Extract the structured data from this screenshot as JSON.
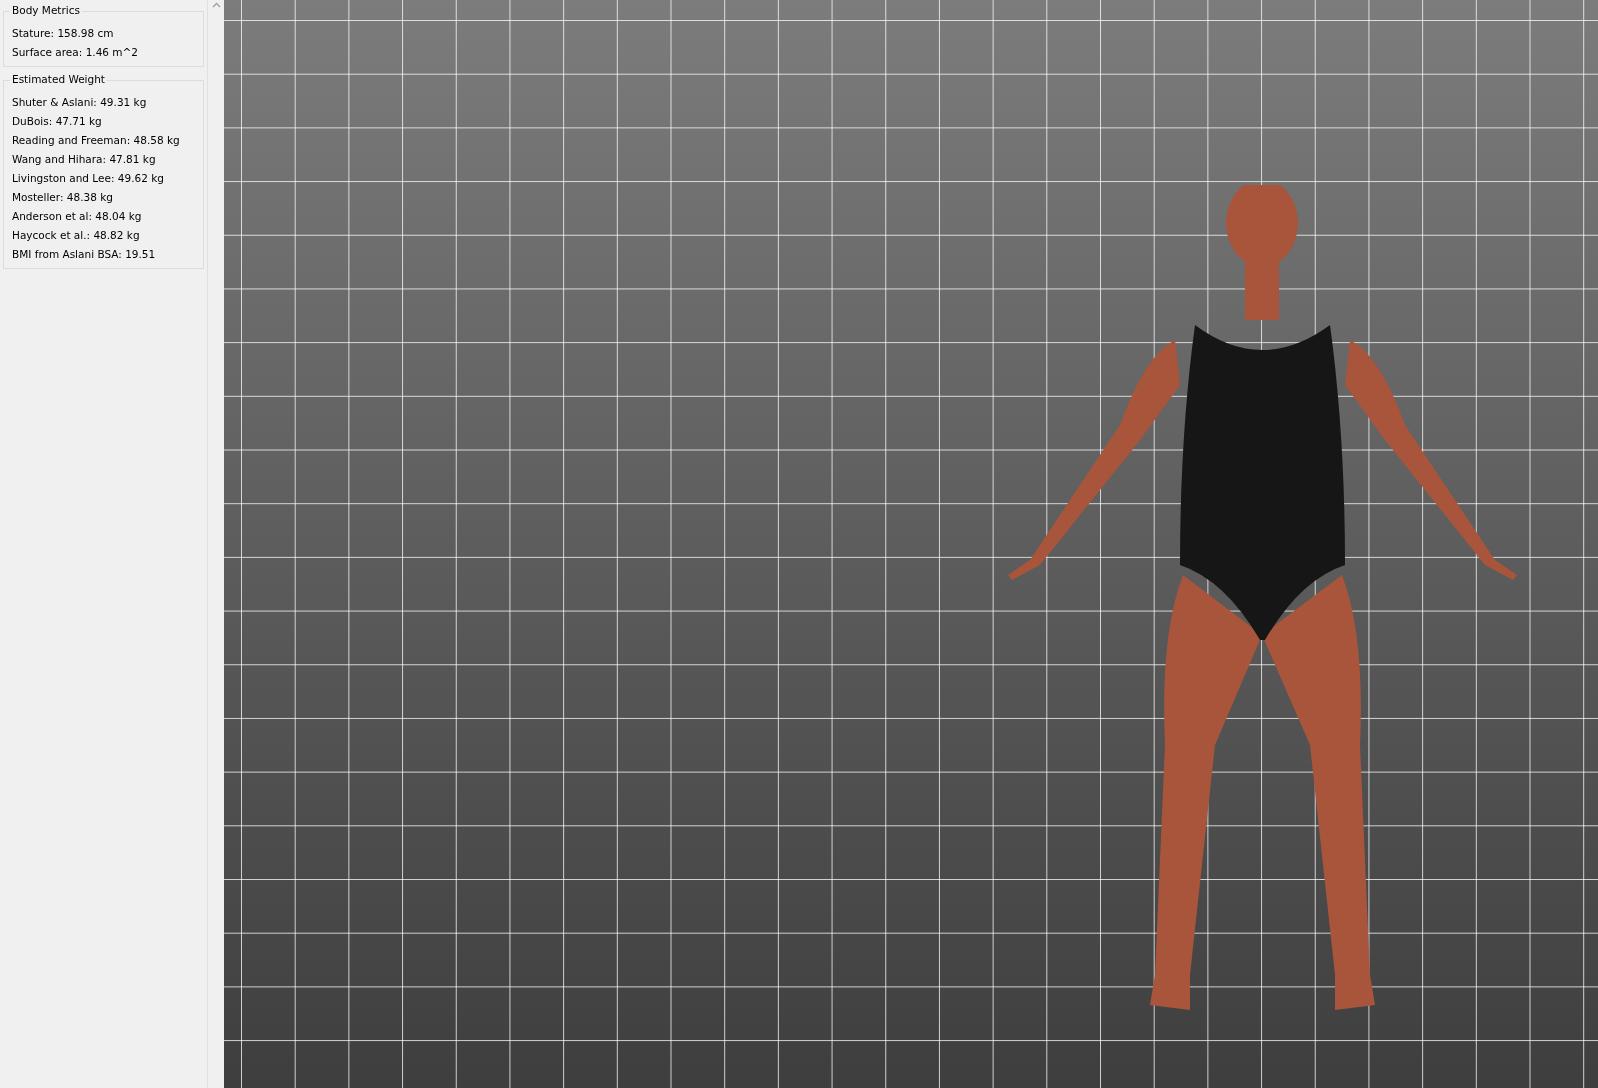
{
  "panels": [
    {
      "title": "Body Metrics",
      "lines": [
        "Stature: 158.98 cm",
        "Surface area: 1.46 m^2"
      ]
    },
    {
      "title": "Estimated Weight",
      "lines": [
        "Shuter & Aslani: 49.31 kg",
        "DuBois: 47.71 kg",
        "Reading and Freeman: 48.58 kg",
        "Wang and Hihara: 47.81 kg",
        "Livingston and Lee: 49.62 kg",
        "Mosteller: 48.38 kg",
        "Anderson et al: 48.04 kg",
        "Haycock et al.: 48.82 kg",
        "BMI from Aslani BSA: 19.51"
      ]
    }
  ]
}
